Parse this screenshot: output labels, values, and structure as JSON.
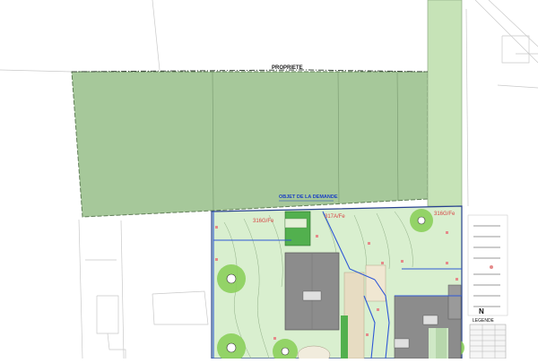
{
  "labels": {
    "propriete": "PROPRIETE",
    "objet_demande": "OBJET DE LA DEMANDE",
    "legende": "LEGENDE",
    "north": "N"
  },
  "elevations": {
    "e1": "316G/Fe",
    "e2": "317A/Fe",
    "e3": "316G/Fe"
  },
  "colors": {
    "field_green": "#a6c89a",
    "strip_green": "#c6e3b7",
    "parcel_light": "#d9efcf",
    "tree_green": "#8bcf5b",
    "building_gray": "#8c8c8c",
    "blue_line": "#2f58d6",
    "pink_marker": "#e58a8a",
    "tan_area": "#e7dcc2"
  }
}
